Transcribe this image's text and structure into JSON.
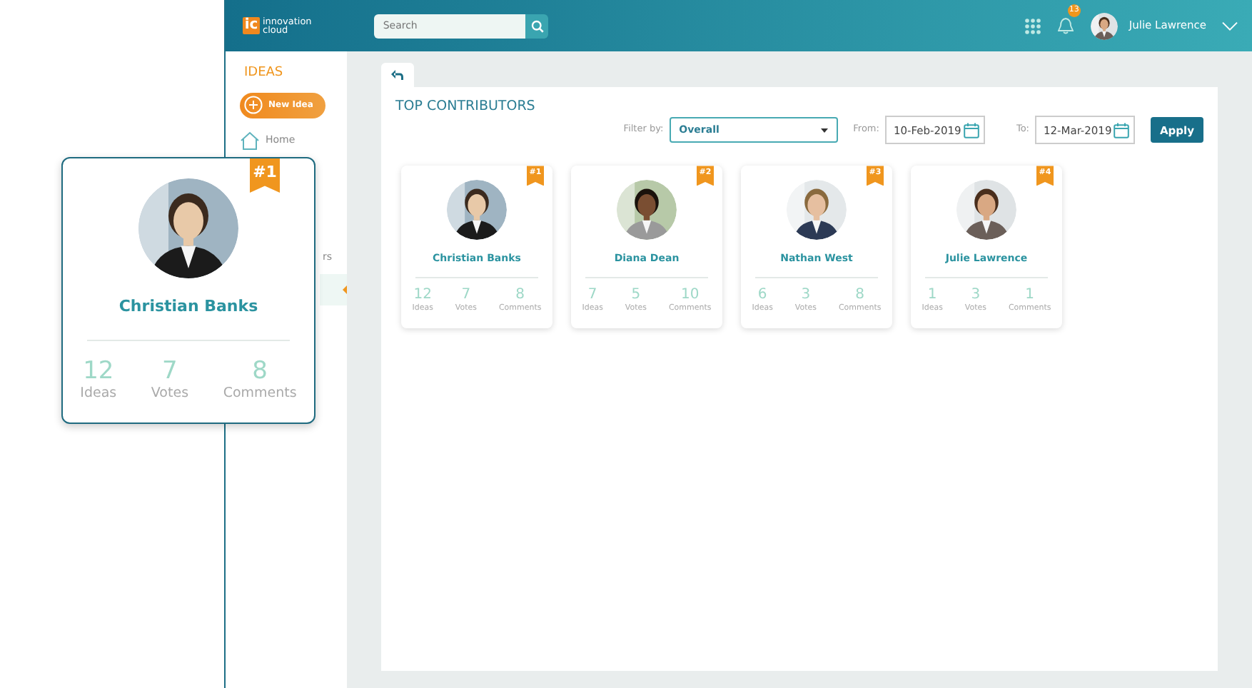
{
  "header": {
    "logo_mark": "ic",
    "logo_lines": [
      "innovation",
      "cloud"
    ],
    "search": {
      "placeholder": "Search"
    },
    "notification_count": "13",
    "user_name": "Julie Lawrence"
  },
  "sidebar": {
    "title": "IDEAS",
    "new_button": "New Idea",
    "items": [
      {
        "kind": "home",
        "label": "Home",
        "selected": false
      },
      {
        "kind": "plain",
        "label": "rs",
        "selected": false
      },
      {
        "kind": "plain",
        "selected": true
      }
    ]
  },
  "page": {
    "title": "TOP CONTRIBUTORS",
    "filter": {
      "label": "Filter by:",
      "value": "Overall"
    },
    "from": {
      "label": "From:",
      "value": "10-Feb-2019"
    },
    "to": {
      "label": "To:",
      "value": "12-Mar-2019"
    },
    "apply": "Apply"
  },
  "contributors": [
    {
      "rank": "#1",
      "name": "Christian Banks",
      "stats": [
        {
          "value": "12",
          "label": "Ideas"
        },
        {
          "value": "7",
          "label": "Votes"
        },
        {
          "value": "8",
          "label": "Comments"
        }
      ]
    },
    {
      "rank": "#2",
      "name": "Diana Dean",
      "stats": [
        {
          "value": "7",
          "label": "Ideas"
        },
        {
          "value": "5",
          "label": "Votes"
        },
        {
          "value": "10",
          "label": "Comments"
        }
      ]
    },
    {
      "rank": "#3",
      "name": "Nathan West",
      "stats": [
        {
          "value": "6",
          "label": "Ideas"
        },
        {
          "value": "3",
          "label": "Votes"
        },
        {
          "value": "8",
          "label": "Comments"
        }
      ]
    },
    {
      "rank": "#4",
      "name": "Julie Lawrence",
      "stats": [
        {
          "value": "1",
          "label": "Ideas"
        },
        {
          "value": "3",
          "label": "Votes"
        },
        {
          "value": "1",
          "label": "Comments"
        }
      ]
    }
  ],
  "callout": {
    "rank": "#1",
    "name": "Christian Banks",
    "stats": [
      {
        "value": "12",
        "label": "Ideas"
      },
      {
        "value": "7",
        "label": "Votes"
      },
      {
        "value": "8",
        "label": "Comments"
      }
    ]
  }
}
